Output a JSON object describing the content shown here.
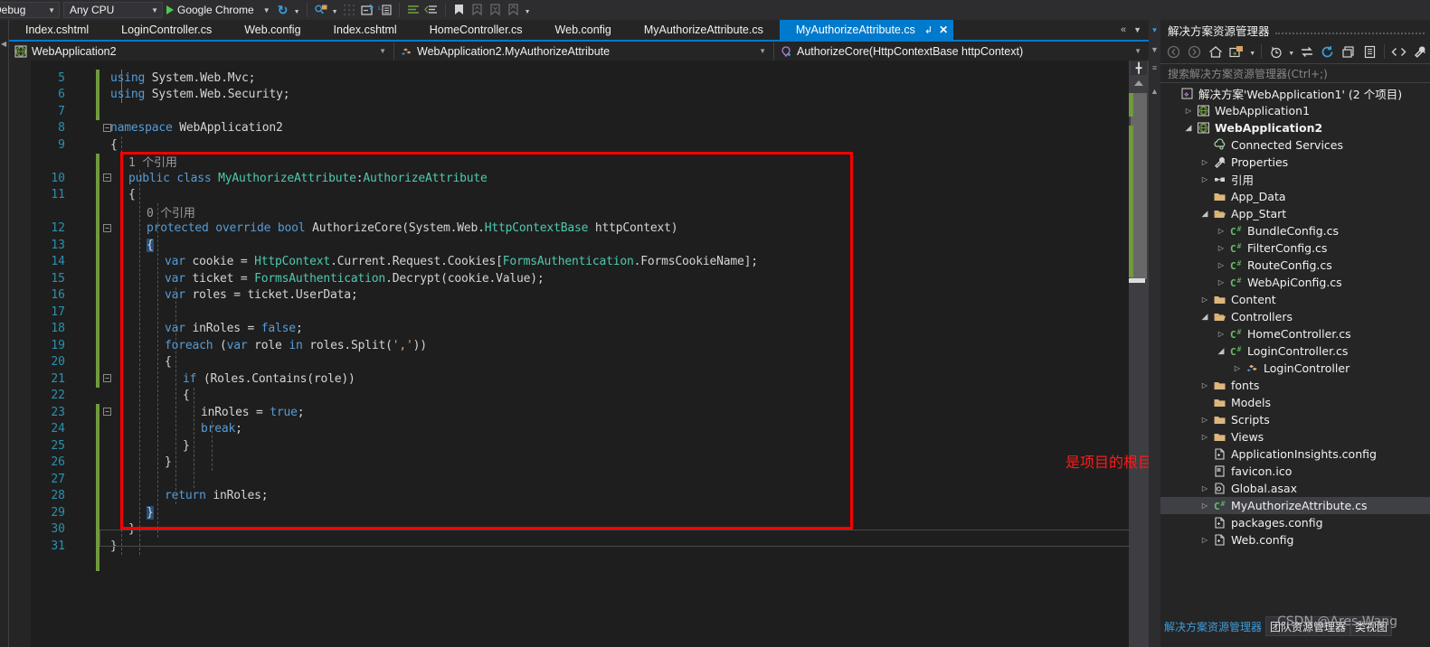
{
  "toolbar": {
    "configuration": "Debug",
    "platform": "Any CPU",
    "run_target": "Google Chrome",
    "icons": [
      "refresh-icon",
      "find-icon",
      "navigate-backward-icon",
      "comment-icon",
      "uncomment-icon",
      "indent-icon",
      "outdent-icon",
      "bookmark-icon",
      "previous-bookmark-icon",
      "next-bookmark-icon",
      "clear-bookmarks-icon"
    ]
  },
  "document_tabs": [
    {
      "label": "Index.cshtml",
      "active": false
    },
    {
      "label": "LoginController.cs",
      "active": false
    },
    {
      "label": "Web.config",
      "active": false
    },
    {
      "label": "Index.cshtml",
      "active": false
    },
    {
      "label": "HomeController.cs",
      "active": false
    },
    {
      "label": "Web.config",
      "active": false
    },
    {
      "label": "MyAuthorizeAttribute.cs",
      "active": false
    },
    {
      "label": "MyAuthorizeAttribute.cs",
      "active": true
    }
  ],
  "navbar": {
    "project": "WebApplication2",
    "type": "WebApplication2.MyAuthorizeAttribute",
    "member": "AuthorizeCore(HttpContextBase httpContext)"
  },
  "code": {
    "lines": [
      {
        "n": 5,
        "indent": 1,
        "tokens": [
          {
            "t": "using ",
            "c": "k"
          },
          {
            "t": "System",
            "c": "p"
          },
          {
            "t": ".",
            "c": "p"
          },
          {
            "t": "Web",
            "c": "p"
          },
          {
            "t": ".",
            "c": "p"
          },
          {
            "t": "Mvc",
            "c": "p"
          },
          {
            "t": ";",
            "c": "p"
          }
        ]
      },
      {
        "n": 6,
        "indent": 1,
        "tokens": [
          {
            "t": "using ",
            "c": "k"
          },
          {
            "t": "System",
            "c": "p"
          },
          {
            "t": ".",
            "c": "p"
          },
          {
            "t": "Web",
            "c": "p"
          },
          {
            "t": ".",
            "c": "p"
          },
          {
            "t": "Security",
            "c": "p"
          },
          {
            "t": ";",
            "c": "p"
          }
        ]
      },
      {
        "n": 7,
        "indent": 1,
        "tokens": []
      },
      {
        "n": 8,
        "indent": 1,
        "tokens": [
          {
            "t": "namespace ",
            "c": "k"
          },
          {
            "t": "WebApplication2",
            "c": "p"
          }
        ]
      },
      {
        "n": 9,
        "indent": 1,
        "tokens": [
          {
            "t": "{",
            "c": "p"
          }
        ]
      },
      {
        "n": "",
        "indent": 2,
        "tokens": [
          {
            "t": "1 个引用",
            "c": "cl"
          }
        ]
      },
      {
        "n": 10,
        "indent": 2,
        "tokens": [
          {
            "t": "public ",
            "c": "k"
          },
          {
            "t": "class ",
            "c": "k"
          },
          {
            "t": "MyAuthorizeAttribute",
            "c": "t"
          },
          {
            "t": ":",
            "c": "p"
          },
          {
            "t": "AuthorizeAttribute",
            "c": "t"
          }
        ]
      },
      {
        "n": 11,
        "indent": 2,
        "tokens": [
          {
            "t": "{",
            "c": "p"
          }
        ]
      },
      {
        "n": "",
        "indent": 3,
        "tokens": [
          {
            "t": "0 个引用",
            "c": "cl"
          }
        ]
      },
      {
        "n": 12,
        "indent": 3,
        "tokens": [
          {
            "t": "protected ",
            "c": "k"
          },
          {
            "t": "override ",
            "c": "k"
          },
          {
            "t": "bool ",
            "c": "k"
          },
          {
            "t": "AuthorizeCore",
            "c": "p"
          },
          {
            "t": "(",
            "c": "p"
          },
          {
            "t": "System",
            "c": "p"
          },
          {
            "t": ".",
            "c": "p"
          },
          {
            "t": "Web",
            "c": "p"
          },
          {
            "t": ".",
            "c": "p"
          },
          {
            "t": "HttpContextBase",
            "c": "t"
          },
          {
            "t": " httpContext)",
            "c": "p"
          }
        ]
      },
      {
        "n": 13,
        "indent": 3,
        "tokens": [
          {
            "t": "{",
            "c": "sel"
          }
        ]
      },
      {
        "n": 14,
        "indent": 4,
        "tokens": [
          {
            "t": "var ",
            "c": "k"
          },
          {
            "t": "cookie = ",
            "c": "p"
          },
          {
            "t": "HttpContext",
            "c": "t"
          },
          {
            "t": ".Current.Request.Cookies[",
            "c": "p"
          },
          {
            "t": "FormsAuthentication",
            "c": "t"
          },
          {
            "t": ".FormsCookieName];",
            "c": "p"
          }
        ]
      },
      {
        "n": 15,
        "indent": 4,
        "tokens": [
          {
            "t": "var ",
            "c": "k"
          },
          {
            "t": "ticket = ",
            "c": "p"
          },
          {
            "t": "FormsAuthentication",
            "c": "t"
          },
          {
            "t": ".Decrypt(cookie.Value);",
            "c": "p"
          }
        ]
      },
      {
        "n": 16,
        "indent": 4,
        "tokens": [
          {
            "t": "var ",
            "c": "k"
          },
          {
            "t": "roles = ticket.UserData;",
            "c": "p"
          }
        ]
      },
      {
        "n": 17,
        "indent": 4,
        "tokens": []
      },
      {
        "n": 18,
        "indent": 4,
        "tokens": [
          {
            "t": "var ",
            "c": "k"
          },
          {
            "t": "inRoles = ",
            "c": "p"
          },
          {
            "t": "false",
            "c": "k"
          },
          {
            "t": ";",
            "c": "p"
          }
        ]
      },
      {
        "n": 19,
        "indent": 4,
        "tokens": [
          {
            "t": "foreach ",
            "c": "k"
          },
          {
            "t": "(",
            "c": "p"
          },
          {
            "t": "var ",
            "c": "k"
          },
          {
            "t": "role ",
            "c": "p"
          },
          {
            "t": "in ",
            "c": "k"
          },
          {
            "t": "roles.Split(",
            "c": "p"
          },
          {
            "t": "','",
            "c": "s"
          },
          {
            "t": "))",
            "c": "p"
          }
        ]
      },
      {
        "n": 20,
        "indent": 4,
        "tokens": [
          {
            "t": "{",
            "c": "p"
          }
        ]
      },
      {
        "n": 21,
        "indent": 5,
        "tokens": [
          {
            "t": "if ",
            "c": "k"
          },
          {
            "t": "(Roles.Contains(role))",
            "c": "p"
          }
        ]
      },
      {
        "n": 22,
        "indent": 5,
        "tokens": [
          {
            "t": "{",
            "c": "p"
          }
        ]
      },
      {
        "n": 23,
        "indent": 6,
        "tokens": [
          {
            "t": "inRoles = ",
            "c": "p"
          },
          {
            "t": "true",
            "c": "k"
          },
          {
            "t": ";",
            "c": "p"
          }
        ]
      },
      {
        "n": 24,
        "indent": 6,
        "tokens": [
          {
            "t": "break",
            "c": "k"
          },
          {
            "t": ";",
            "c": "p"
          }
        ]
      },
      {
        "n": 25,
        "indent": 5,
        "tokens": [
          {
            "t": "}",
            "c": "p"
          }
        ]
      },
      {
        "n": 26,
        "indent": 4,
        "tokens": [
          {
            "t": "}",
            "c": "p"
          }
        ]
      },
      {
        "n": 27,
        "indent": 4,
        "tokens": []
      },
      {
        "n": 28,
        "indent": 4,
        "tokens": [
          {
            "t": "return ",
            "c": "k"
          },
          {
            "t": "inRoles;",
            "c": "p"
          }
        ]
      },
      {
        "n": 29,
        "indent": 3,
        "tokens": [
          {
            "t": "}",
            "c": "sel"
          }
        ]
      },
      {
        "n": 30,
        "indent": 2,
        "tokens": [
          {
            "t": "}",
            "c": "p"
          }
        ]
      },
      {
        "n": 31,
        "indent": 1,
        "tokens": [
          {
            "t": "}",
            "c": "p"
          }
        ]
      }
    ]
  },
  "solution_explorer": {
    "title": "解决方案资源管理器",
    "search_placeholder": "搜索解决方案资源管理器(Ctrl+;)",
    "toolbar_icons": [
      "back-icon",
      "forward-icon",
      "home-icon",
      "pending-changes-icon",
      "history-icon",
      "sync-icon",
      "refresh-icon",
      "collapse-all-icon",
      "show-all-files-icon",
      "code-view-icon",
      "properties-icon"
    ],
    "tree": [
      {
        "label": "解决方案'WebApplication1' (2 个项目)",
        "indent": 0,
        "arrow": "",
        "icon": "solution-icon",
        "bold": false
      },
      {
        "label": "WebApplication1",
        "indent": 1,
        "arrow": "collapsed",
        "icon": "project-icon",
        "bold": false
      },
      {
        "label": "WebApplication2",
        "indent": 1,
        "arrow": "expanded",
        "icon": "project-icon",
        "bold": true
      },
      {
        "label": "Connected Services",
        "indent": 2,
        "arrow": "",
        "icon": "connected-services-icon",
        "bold": false
      },
      {
        "label": "Properties",
        "indent": 2,
        "arrow": "collapsed",
        "icon": "wrench-icon",
        "bold": false
      },
      {
        "label": "引用",
        "indent": 2,
        "arrow": "collapsed",
        "icon": "references-icon",
        "bold": false
      },
      {
        "label": "App_Data",
        "indent": 2,
        "arrow": "",
        "icon": "folder-icon",
        "bold": false
      },
      {
        "label": "App_Start",
        "indent": 2,
        "arrow": "expanded",
        "icon": "folder-open-icon",
        "bold": false
      },
      {
        "label": "BundleConfig.cs",
        "indent": 3,
        "arrow": "collapsed",
        "icon": "csharp-icon",
        "bold": false
      },
      {
        "label": "FilterConfig.cs",
        "indent": 3,
        "arrow": "collapsed",
        "icon": "csharp-icon",
        "bold": false
      },
      {
        "label": "RouteConfig.cs",
        "indent": 3,
        "arrow": "collapsed",
        "icon": "csharp-icon",
        "bold": false
      },
      {
        "label": "WebApiConfig.cs",
        "indent": 3,
        "arrow": "collapsed",
        "icon": "csharp-icon",
        "bold": false
      },
      {
        "label": "Content",
        "indent": 2,
        "arrow": "collapsed",
        "icon": "folder-icon",
        "bold": false
      },
      {
        "label": "Controllers",
        "indent": 2,
        "arrow": "expanded",
        "icon": "folder-open-icon",
        "bold": false
      },
      {
        "label": "HomeController.cs",
        "indent": 3,
        "arrow": "collapsed",
        "icon": "csharp-icon",
        "bold": false
      },
      {
        "label": "LoginController.cs",
        "indent": 3,
        "arrow": "expanded",
        "icon": "csharp-icon",
        "bold": false
      },
      {
        "label": "LoginController",
        "indent": 4,
        "arrow": "collapsed",
        "icon": "class-icon",
        "bold": false
      },
      {
        "label": "fonts",
        "indent": 2,
        "arrow": "collapsed",
        "icon": "folder-icon",
        "bold": false
      },
      {
        "label": "Models",
        "indent": 2,
        "arrow": "",
        "icon": "folder-icon",
        "bold": false
      },
      {
        "label": "Scripts",
        "indent": 2,
        "arrow": "collapsed",
        "icon": "folder-icon",
        "bold": false
      },
      {
        "label": "Views",
        "indent": 2,
        "arrow": "collapsed",
        "icon": "folder-icon",
        "bold": false
      },
      {
        "label": "ApplicationInsights.config",
        "indent": 2,
        "arrow": "",
        "icon": "config-icon",
        "bold": false
      },
      {
        "label": "favicon.ico",
        "indent": 2,
        "arrow": "",
        "icon": "image-icon",
        "bold": false
      },
      {
        "label": "Global.asax",
        "indent": 2,
        "arrow": "collapsed",
        "icon": "asax-icon",
        "bold": false
      },
      {
        "label": "MyAuthorizeAttribute.cs",
        "indent": 2,
        "arrow": "collapsed",
        "icon": "csharp-icon",
        "bold": false,
        "selected": true
      },
      {
        "label": "packages.config",
        "indent": 2,
        "arrow": "",
        "icon": "config-icon",
        "bold": false
      },
      {
        "label": "Web.config",
        "indent": 2,
        "arrow": "collapsed",
        "icon": "config-icon",
        "bold": false
      }
    ],
    "bottom_tabs": [
      {
        "label": "解决方案资源管理器",
        "active": true
      },
      {
        "label": "团队资源管理器",
        "active": false
      },
      {
        "label": "类视图",
        "active": false
      }
    ]
  },
  "annotations": {
    "root_directory_note": "是项目的根目录",
    "watermark": "CSDN @Ares-Wang",
    "box_color": "#fa0000"
  }
}
